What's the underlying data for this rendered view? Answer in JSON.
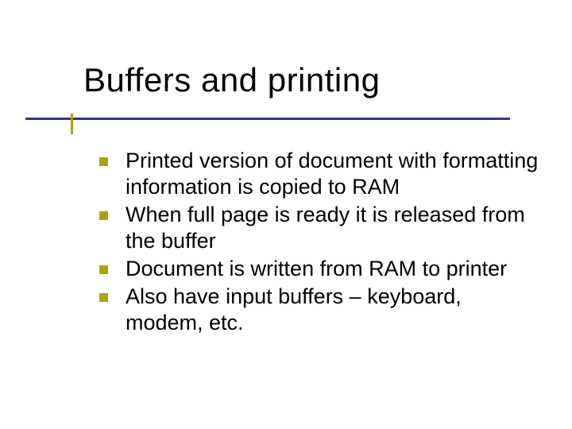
{
  "colors": {
    "rule": "#333399",
    "accent": "#a6a600"
  },
  "title": "Buffers and printing",
  "bullets": [
    {
      "text": "Printed version of document with formatting information is copied to RAM"
    },
    {
      "text": "When full page is ready it is released from the buffer"
    },
    {
      "text": "Document is written from RAM to printer"
    },
    {
      "text": "Also have input buffers – keyboard, modem, etc."
    }
  ]
}
